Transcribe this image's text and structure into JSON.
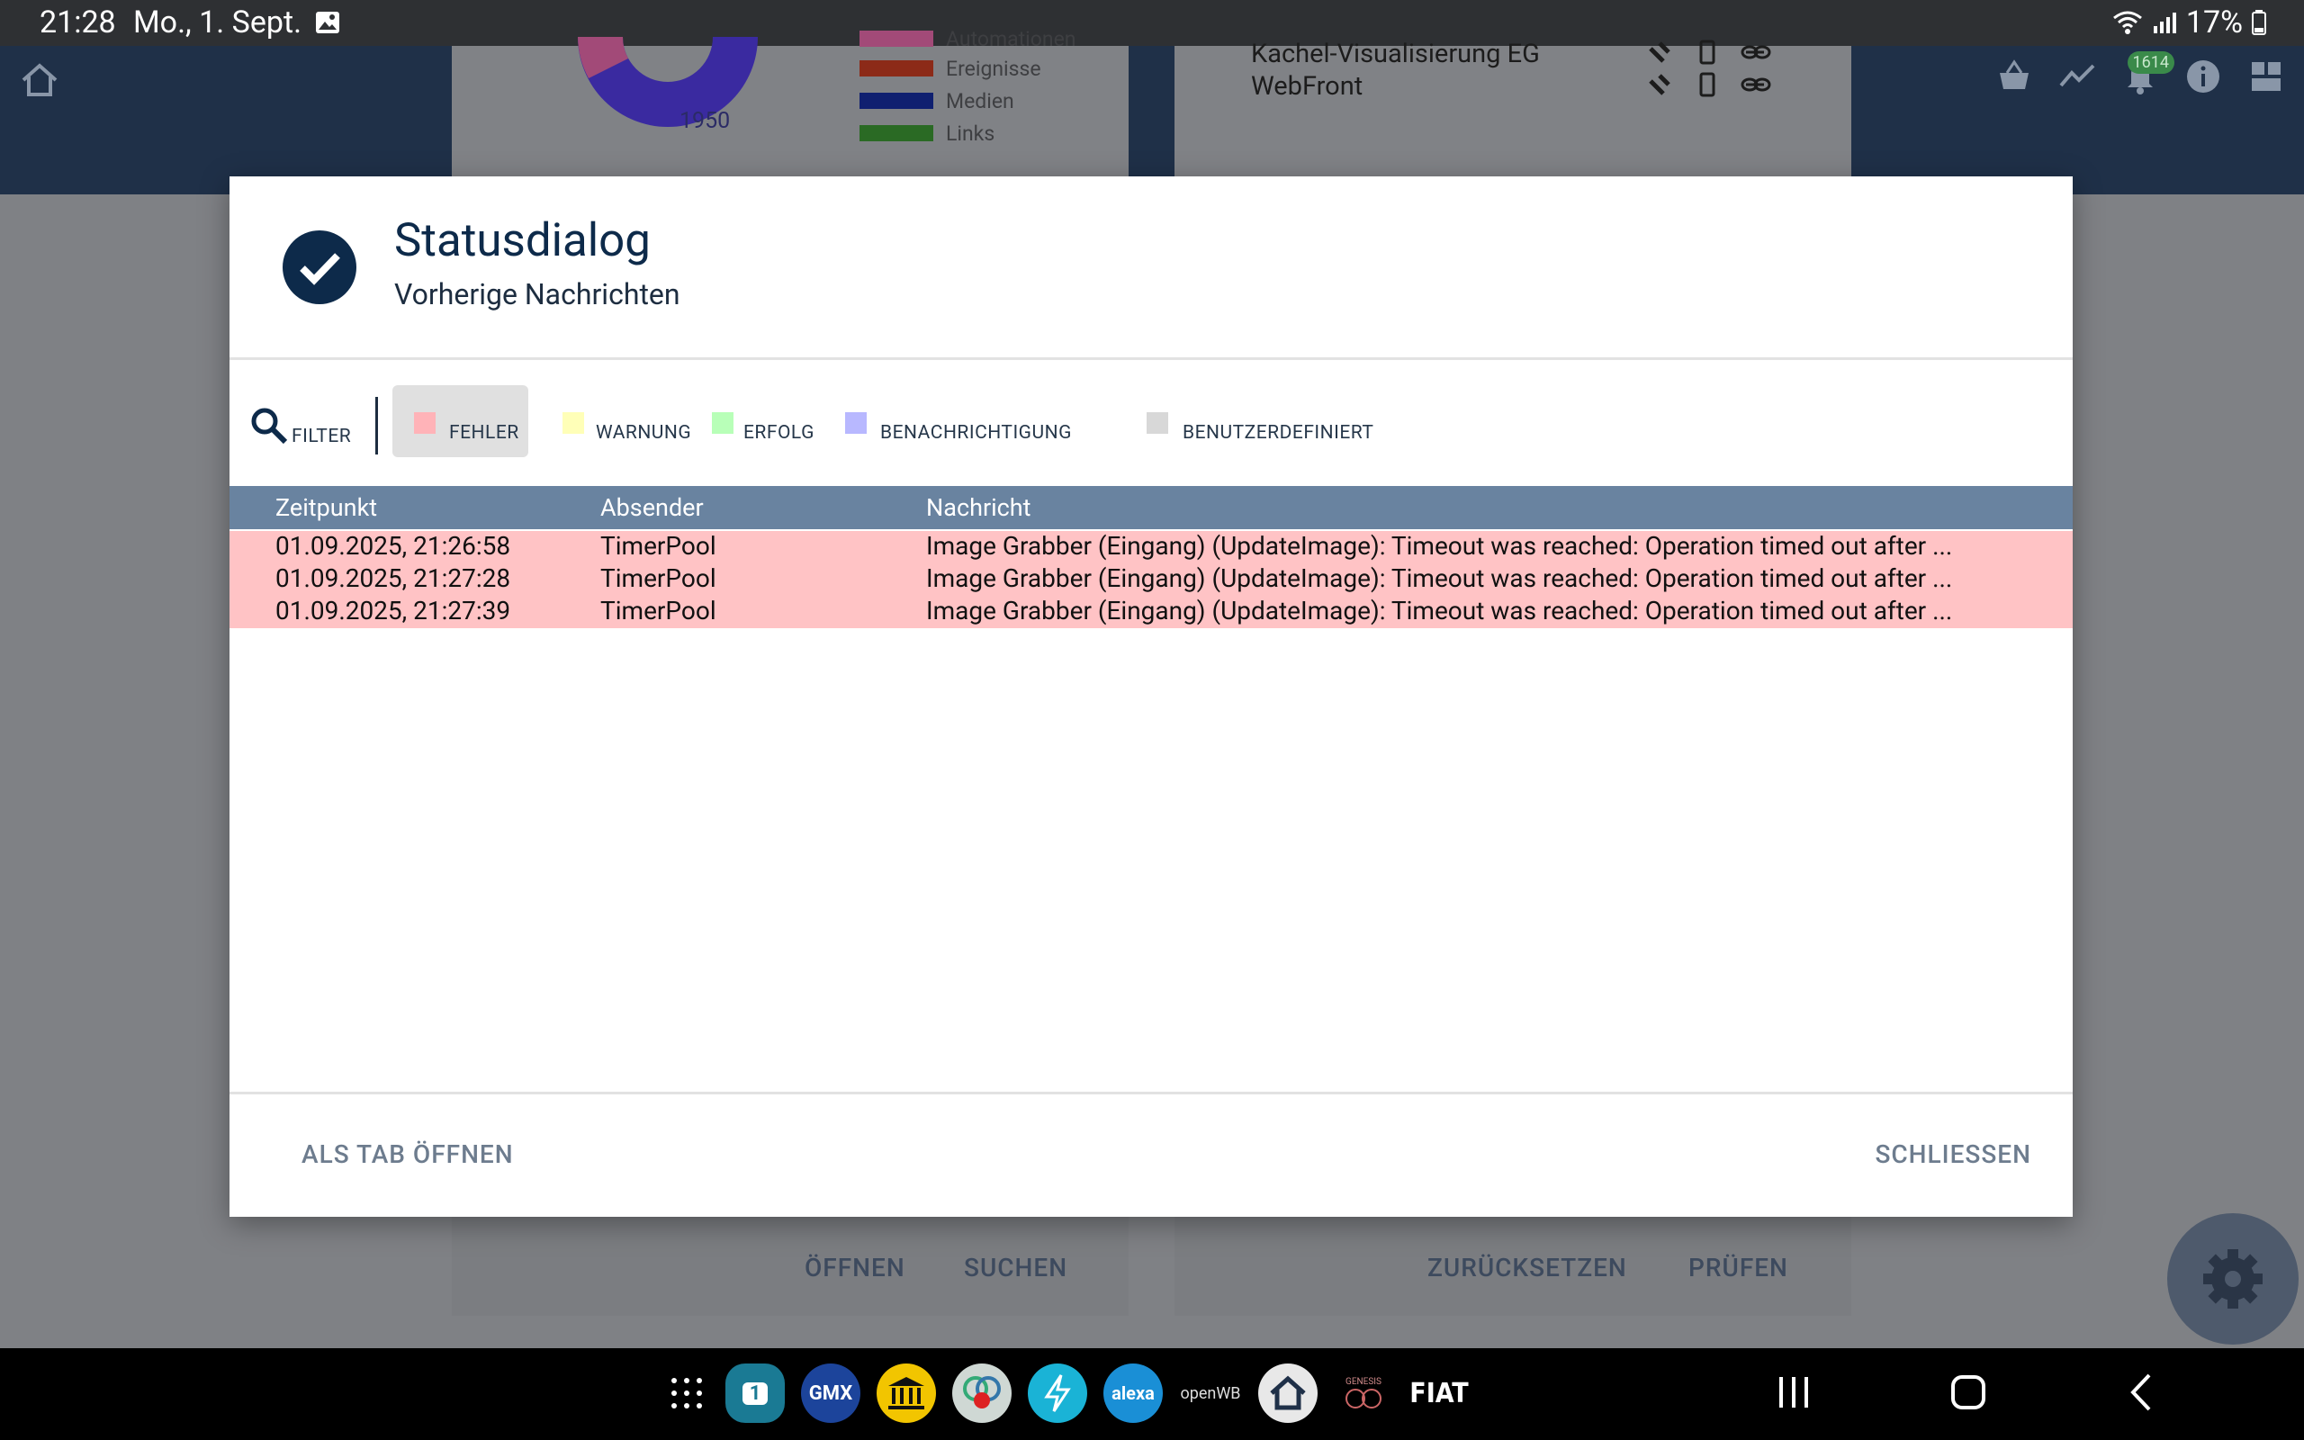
{
  "statusbar": {
    "time": "21:28",
    "date": "Mo., 1. Sept.",
    "battery": "17%"
  },
  "appbar": {
    "badge_count": "1614"
  },
  "background": {
    "legend": [
      {
        "label": "Automationen",
        "color": "#a24a78"
      },
      {
        "label": "Ereignisse",
        "color": "#8c2a18"
      },
      {
        "label": "Medien",
        "color": "#102070"
      },
      {
        "label": "Links",
        "color": "#2a6a24"
      }
    ],
    "donut_value": "1950",
    "card2_lines": [
      "Kachel-Visualisierung EG",
      "WebFront"
    ],
    "card3_buttons": [
      "ÖFFNEN",
      "SUCHEN"
    ],
    "card4_buttons": [
      "ZURÜCKSETZEN",
      "PRÜFEN"
    ]
  },
  "dialog": {
    "title": "Statusdialog",
    "subtitle": "Vorherige Nachrichten",
    "filter_label": "FILTER",
    "chips": [
      {
        "label": "FEHLER",
        "color": "#ffb3b8",
        "active": true
      },
      {
        "label": "WARNUNG",
        "color": "#ffffb8",
        "active": false
      },
      {
        "label": "ERFOLG",
        "color": "#b8ffb8",
        "active": false
      },
      {
        "label": "BENACHRICHTIGUNG",
        "color": "#b8b8ff",
        "active": false
      },
      {
        "label": "BENUTZERDEFINIERT",
        "color": "#d8d8d8",
        "active": false
      }
    ],
    "columns": [
      "Zeitpunkt",
      "Absender",
      "Nachricht"
    ],
    "rows": [
      {
        "time": "01.09.2025, 21:26:58",
        "sender": "TimerPool",
        "message": "Image Grabber (Eingang) (UpdateImage): Timeout was reached: Operation timed out after ..."
      },
      {
        "time": "01.09.2025, 21:27:28",
        "sender": "TimerPool",
        "message": "Image Grabber (Eingang) (UpdateImage): Timeout was reached: Operation timed out after ..."
      },
      {
        "time": "01.09.2025, 21:27:39",
        "sender": "TimerPool",
        "message": "Image Grabber (Eingang) (UpdateImage): Timeout was reached: Operation timed out after ..."
      }
    ],
    "open_tab_label": "ALS TAB ÖFFNEN",
    "close_label": "SCHLIESSEN"
  },
  "dock": [
    "1",
    "GMX",
    "alexa",
    "openWB",
    "GENESIS",
    "FIAT"
  ]
}
